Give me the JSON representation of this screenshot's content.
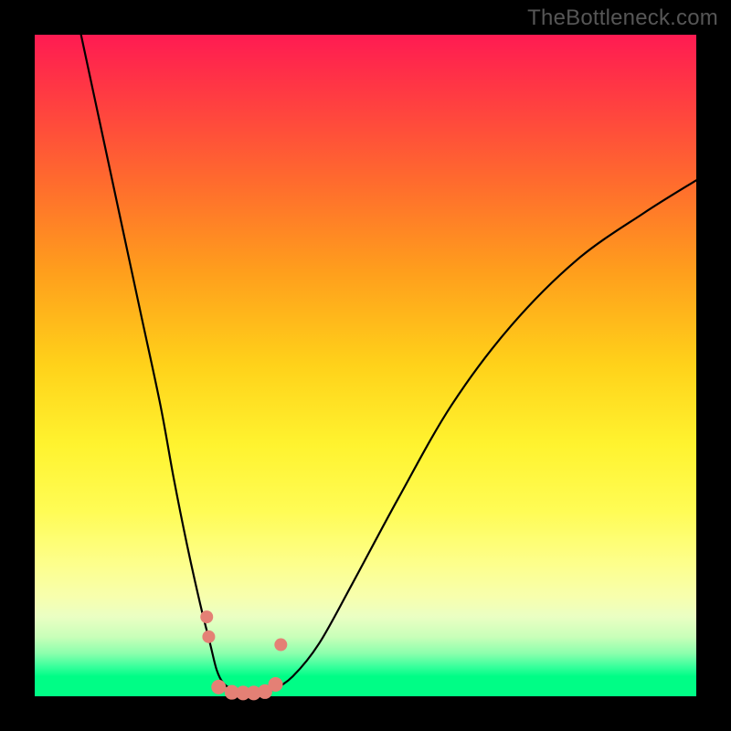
{
  "watermark": "TheBottleneck.com",
  "colors": {
    "curve": "#000000",
    "markers": "#e48075",
    "frame": "#000000"
  },
  "chart_data": {
    "type": "line",
    "title": "",
    "xlabel": "",
    "ylabel": "",
    "xlim": [
      0,
      100
    ],
    "ylim": [
      0,
      100
    ],
    "note": "Axes are unlabeled in the source image; values below are estimated from pixel positions on a 0–100 normalized scale where y=100 is top (worst) and y=0 is bottom (best/green).",
    "series": [
      {
        "name": "bottleneck-curve",
        "x": [
          7,
          10,
          13,
          16,
          19,
          21,
          23,
          25,
          26.5,
          27.5,
          28.5,
          30,
          32,
          34,
          36,
          39,
          43,
          48,
          55,
          63,
          72,
          82,
          92,
          100
        ],
        "y": [
          100,
          86,
          72,
          58,
          44,
          33,
          23,
          14,
          8,
          4,
          2,
          1,
          0.5,
          0.5,
          1,
          3,
          8,
          17,
          30,
          44,
          56,
          66,
          73,
          78
        ]
      }
    ],
    "markers": {
      "name": "highlighted-points-near-trough",
      "x": [
        26.0,
        26.3,
        27.8,
        29.8,
        31.5,
        33.1,
        34.8,
        36.4,
        37.2
      ],
      "y": [
        12.0,
        9.0,
        1.4,
        0.6,
        0.5,
        0.5,
        0.7,
        1.8,
        7.8
      ],
      "r": [
        7,
        7,
        8,
        8,
        8,
        8,
        8,
        8,
        7
      ]
    },
    "background_gradient_stops": [
      {
        "pos": 0.0,
        "color": "#ff1b52"
      },
      {
        "pos": 0.22,
        "color": "#ff6a2e"
      },
      {
        "pos": 0.5,
        "color": "#ffd21a"
      },
      {
        "pos": 0.72,
        "color": "#fffc55"
      },
      {
        "pos": 0.88,
        "color": "#eaffc3"
      },
      {
        "pos": 0.95,
        "color": "#39ff9c"
      },
      {
        "pos": 1.0,
        "color": "#00fd86"
      }
    ]
  }
}
